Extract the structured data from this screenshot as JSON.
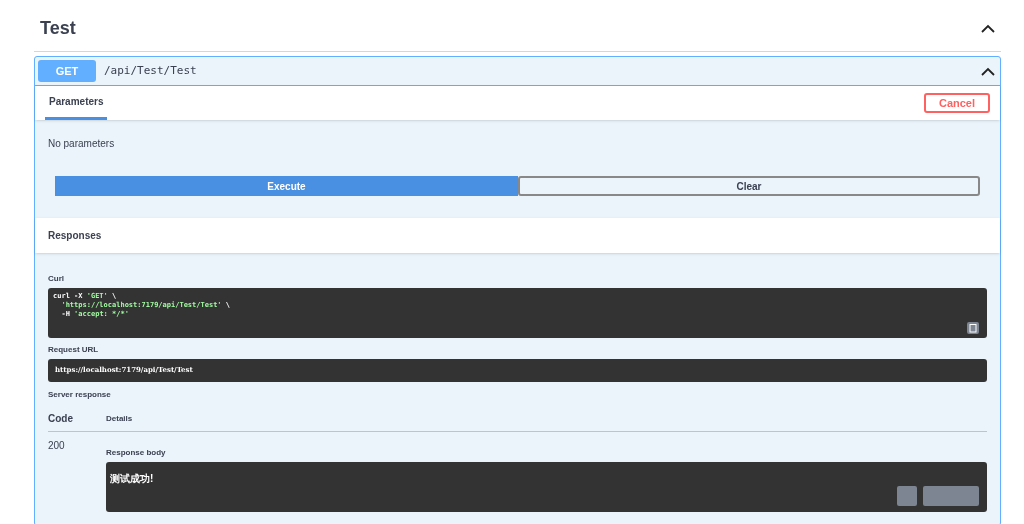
{
  "section": {
    "title": "Test",
    "expanded": true
  },
  "operation": {
    "method": "GET",
    "path": "/api/Test/Test",
    "expanded": true
  },
  "parameters": {
    "tab": "Parameters",
    "cancel": "Cancel",
    "empty": "No parameters"
  },
  "actions": {
    "execute": "Execute",
    "clear": "Clear"
  },
  "responses": {
    "title": "Responses",
    "curl_label": "Curl",
    "curl_lines": [
      {
        "text": "curl -X ",
        "arg": "'GET'",
        "tail": " \\"
      },
      {
        "arg": "'https://localhost:7179/api/Test/Test'",
        "tail": " \\"
      },
      {
        "text": "-H ",
        "arg": "'accept: */*'"
      }
    ],
    "request_url_label": "Request URL",
    "request_url": "https://localhost:7179/api/Test/Test",
    "server_response_label": "Server response",
    "columns": [
      "Code",
      "Details"
    ],
    "code": "200",
    "body_label": "Response body",
    "body": "测试成功!"
  }
}
